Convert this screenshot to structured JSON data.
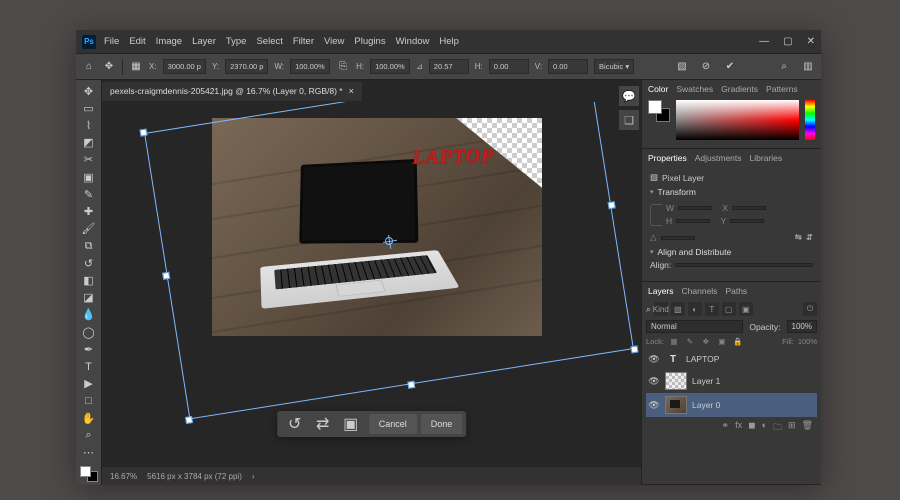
{
  "app": {
    "logo": "Ps"
  },
  "menu": [
    "File",
    "Edit",
    "Image",
    "Layer",
    "Type",
    "Select",
    "Filter",
    "View",
    "Plugins",
    "Window",
    "Help"
  ],
  "window_controls": {
    "min": "—",
    "max": "▢",
    "close": "✕"
  },
  "options": {
    "x_label": "X:",
    "x_value": "3000.00 p",
    "y_label": "Y:",
    "y_value": "2370.00 p",
    "w_label": "W:",
    "w_value": "100.00%",
    "h_label": "H:",
    "h_value": "100.00%",
    "angle_label": "⊿",
    "angle_value": "20.57",
    "skew_h_label": "H:",
    "skew_h_value": "0.00",
    "skew_v_label": "V:",
    "skew_v_value": "0.00",
    "interp": "Bicubic"
  },
  "document": {
    "tab_title": "pexels-craigmdennis-205421.jpg @ 16.7% (Layer 0, RGB/8) *",
    "overlay_text": "LAPTOP",
    "zoom": "16.67%",
    "status": "5616 px x 3784 px (72 ppi)"
  },
  "commit": {
    "cancel": "Cancel",
    "done": "Done"
  },
  "panels": {
    "color_tabs": [
      "Color",
      "Swatches",
      "Gradients",
      "Patterns"
    ],
    "props_tabs": [
      "Properties",
      "Adjustments",
      "Libraries"
    ],
    "props_kind": "Pixel Layer",
    "transform_title": "Transform",
    "align_title": "Align and Distribute",
    "align_label": "Align:",
    "layers_tabs": [
      "Layers",
      "Channels",
      "Paths"
    ],
    "kind_label": "Kind",
    "blend_mode": "Normal",
    "opacity_label": "Opacity:",
    "opacity_value": "100%",
    "lock_label": "Lock:",
    "fill_label": "Fill:",
    "fill_value": "100%",
    "layers": [
      {
        "name": "LAPTOP",
        "type": "text",
        "visible": true
      },
      {
        "name": "Layer 1",
        "type": "pixel-trans",
        "visible": true
      },
      {
        "name": "Layer 0",
        "type": "pixel-photo",
        "visible": true
      }
    ]
  }
}
